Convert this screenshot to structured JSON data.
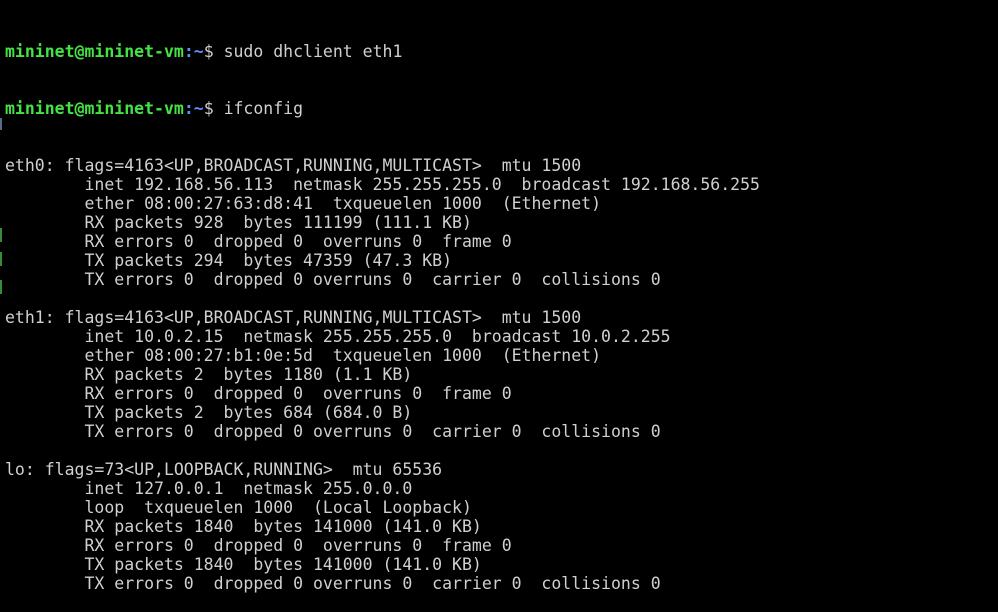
{
  "prompts": [
    {
      "user_host": "mininet@mininet-vm",
      "path": ":~",
      "symbol": "$ ",
      "command": "sudo dhclient eth1"
    },
    {
      "user_host": "mininet@mininet-vm",
      "path": ":~",
      "symbol": "$ ",
      "command": "ifconfig"
    }
  ],
  "output": [
    "eth0: flags=4163<UP,BROADCAST,RUNNING,MULTICAST>  mtu 1500",
    "        inet 192.168.56.113  netmask 255.255.255.0  broadcast 192.168.56.255",
    "        ether 08:00:27:63:d8:41  txqueuelen 1000  (Ethernet)",
    "        RX packets 928  bytes 111199 (111.1 KB)",
    "        RX errors 0  dropped 0  overruns 0  frame 0",
    "        TX packets 294  bytes 47359 (47.3 KB)",
    "        TX errors 0  dropped 0 overruns 0  carrier 0  collisions 0",
    "",
    "eth1: flags=4163<UP,BROADCAST,RUNNING,MULTICAST>  mtu 1500",
    "        inet 10.0.2.15  netmask 255.255.255.0  broadcast 10.0.2.255",
    "        ether 08:00:27:b1:0e:5d  txqueuelen 1000  (Ethernet)",
    "        RX packets 2  bytes 1180 (1.1 KB)",
    "        RX errors 0  dropped 0  overruns 0  frame 0",
    "        TX packets 2  bytes 684 (684.0 B)",
    "        TX errors 0  dropped 0 overruns 0  carrier 0  collisions 0",
    "",
    "lo: flags=73<UP,LOOPBACK,RUNNING>  mtu 65536",
    "        inet 127.0.0.1  netmask 255.0.0.0",
    "        loop  txqueuelen 1000  (Local Loopback)",
    "        RX packets 1840  bytes 141000 (141.0 KB)",
    "        RX errors 0  dropped 0  overruns 0  frame 0",
    "        TX packets 1840  bytes 141000 (141.0 KB)",
    "        TX errors 0  dropped 0 overruns 0  carrier 0  collisions 0"
  ],
  "colors": {
    "background": "#000000",
    "text": "#d0d0d0",
    "prompt_user": "#44e244",
    "prompt_path": "#5f8fff"
  }
}
